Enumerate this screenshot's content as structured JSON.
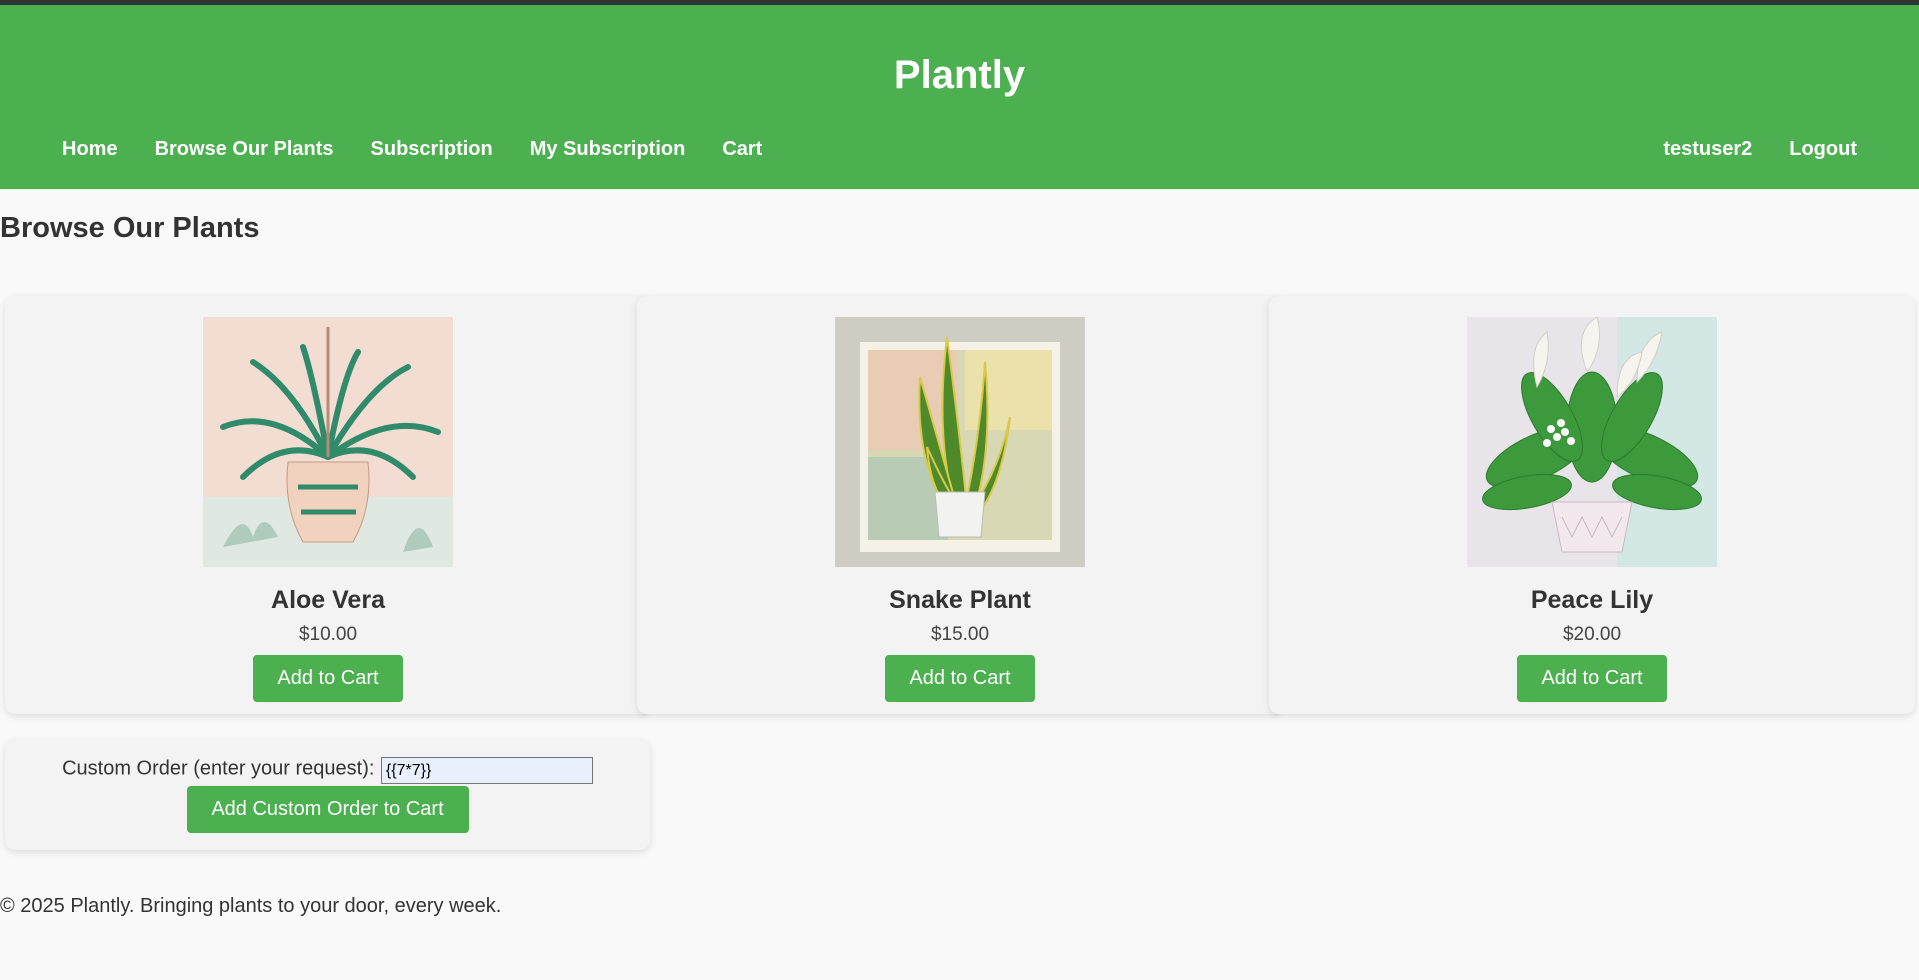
{
  "header": {
    "brand": "Plantly",
    "nav_left": [
      "Home",
      "Browse Our Plants",
      "Subscription",
      "My Subscription",
      "Cart"
    ],
    "nav_right": [
      "testuser2",
      "Logout"
    ]
  },
  "page_title": "Browse Our Plants",
  "products": [
    {
      "name": "Aloe Vera",
      "price": "$10.00",
      "button": "Add to Cart"
    },
    {
      "name": "Snake Plant",
      "price": "$15.00",
      "button": "Add to Cart"
    },
    {
      "name": "Peace Lily",
      "price": "$20.00",
      "button": "Add to Cart"
    }
  ],
  "custom_order": {
    "label": "Custom Order (enter your request):",
    "value": "{{7*7}}",
    "button": "Add Custom Order to Cart"
  },
  "footer": "© 2025 Plantly. Bringing plants to your door, every week.",
  "colors": {
    "brand_green": "#4caf50",
    "topbar": "#2f3437",
    "background": "#f9f9f9"
  }
}
